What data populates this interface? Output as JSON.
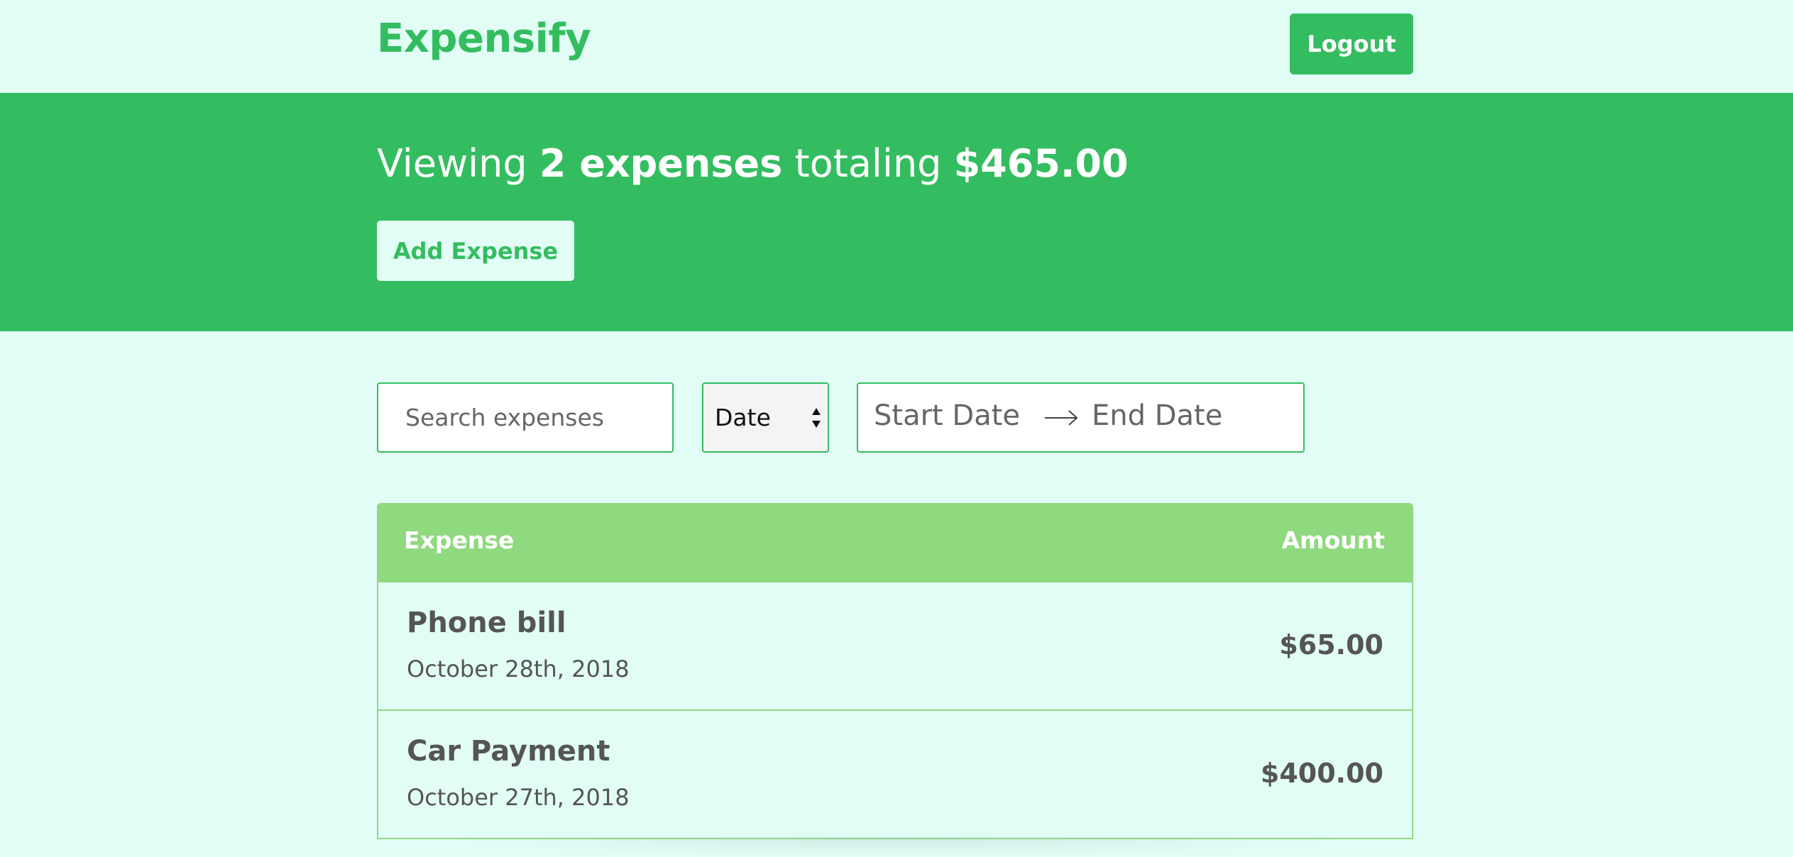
{
  "header": {
    "brand": "Expensify",
    "logout_label": "Logout"
  },
  "summary": {
    "prefix": "Viewing ",
    "count_text": "2 expenses",
    "middle": " totaling ",
    "total": "$465.00",
    "add_label": "Add Expense"
  },
  "filters": {
    "search_placeholder": "Search expenses",
    "sort_selected": "Date",
    "start_date_placeholder": "Start Date",
    "end_date_placeholder": "End Date"
  },
  "table": {
    "col_expense": "Expense",
    "col_amount": "Amount",
    "rows": [
      {
        "description": "Phone bill",
        "date": "October 28th, 2018",
        "amount": "$65.00"
      },
      {
        "description": "Car Payment",
        "date": "October 27th, 2018",
        "amount": "$400.00"
      }
    ]
  },
  "colors": {
    "brand_green": "#34bd60",
    "background": "#e2fdf6",
    "table_header": "#8fd97f"
  }
}
